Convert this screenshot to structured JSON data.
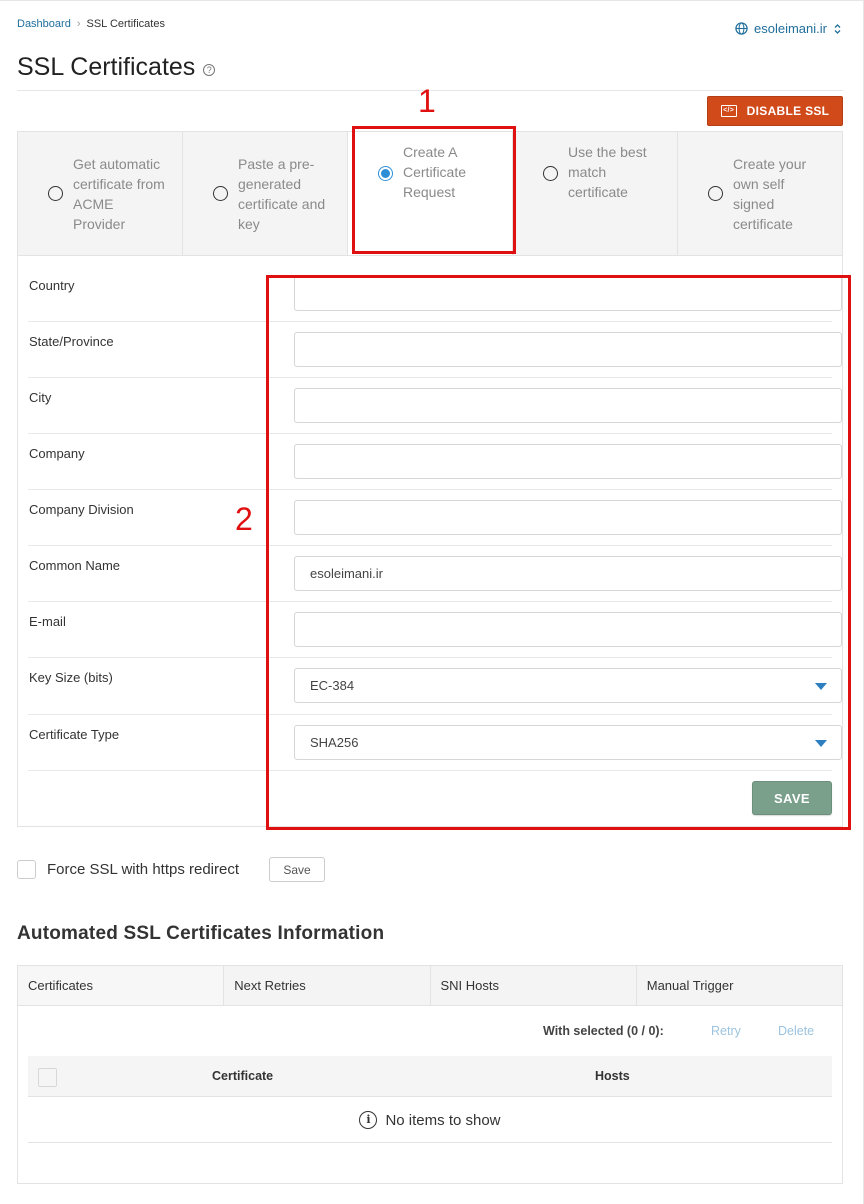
{
  "breadcrumb": {
    "home": "Dashboard",
    "separator": "›",
    "current": "SSL Certificates"
  },
  "domain_switch": {
    "label": "esoleimani.ir",
    "icon": "globe-icon",
    "caret": "⌃⌄"
  },
  "page": {
    "title": "SSL Certificates",
    "help": "?"
  },
  "disable_button": {
    "label": "DISABLE SSL",
    "color": "#d14a1a"
  },
  "annotations": {
    "one": "1",
    "two": "2"
  },
  "options": [
    {
      "label": "Get automatic certificate from ACME Provider",
      "selected": false
    },
    {
      "label": "Paste a pre-generated certificate and key",
      "selected": false
    },
    {
      "label": "Create A Certificate Request",
      "selected": true
    },
    {
      "label": "Use the best match certificate",
      "selected": false
    },
    {
      "label": "Create your own self signed certificate",
      "selected": false
    }
  ],
  "form": {
    "country": {
      "label": "Country",
      "value": ""
    },
    "state": {
      "label": "State/Province",
      "value": ""
    },
    "city": {
      "label": "City",
      "value": ""
    },
    "company": {
      "label": "Company",
      "value": ""
    },
    "division": {
      "label": "Company Division",
      "value": ""
    },
    "common_name": {
      "label": "Common Name",
      "value": "esoleimani.ir"
    },
    "email": {
      "label": "E-mail",
      "value": ""
    },
    "key_size": {
      "label": "Key Size (bits)",
      "value": "EC-384"
    },
    "cert_type": {
      "label": "Certificate Type",
      "value": "SHA256"
    },
    "save_label": "SAVE"
  },
  "force_ssl": {
    "label": "Force SSL with https redirect",
    "save_label": "Save"
  },
  "automated": {
    "title": "Automated SSL Certificates Information",
    "tabs": [
      "Certificates",
      "Next Retries",
      "SNI Hosts",
      "Manual Trigger"
    ],
    "with_selected": "With selected (0 / 0):",
    "retry": "Retry",
    "delete": "Delete",
    "columns": {
      "certificate": "Certificate",
      "hosts": "Hosts"
    },
    "empty": "No items to show"
  }
}
